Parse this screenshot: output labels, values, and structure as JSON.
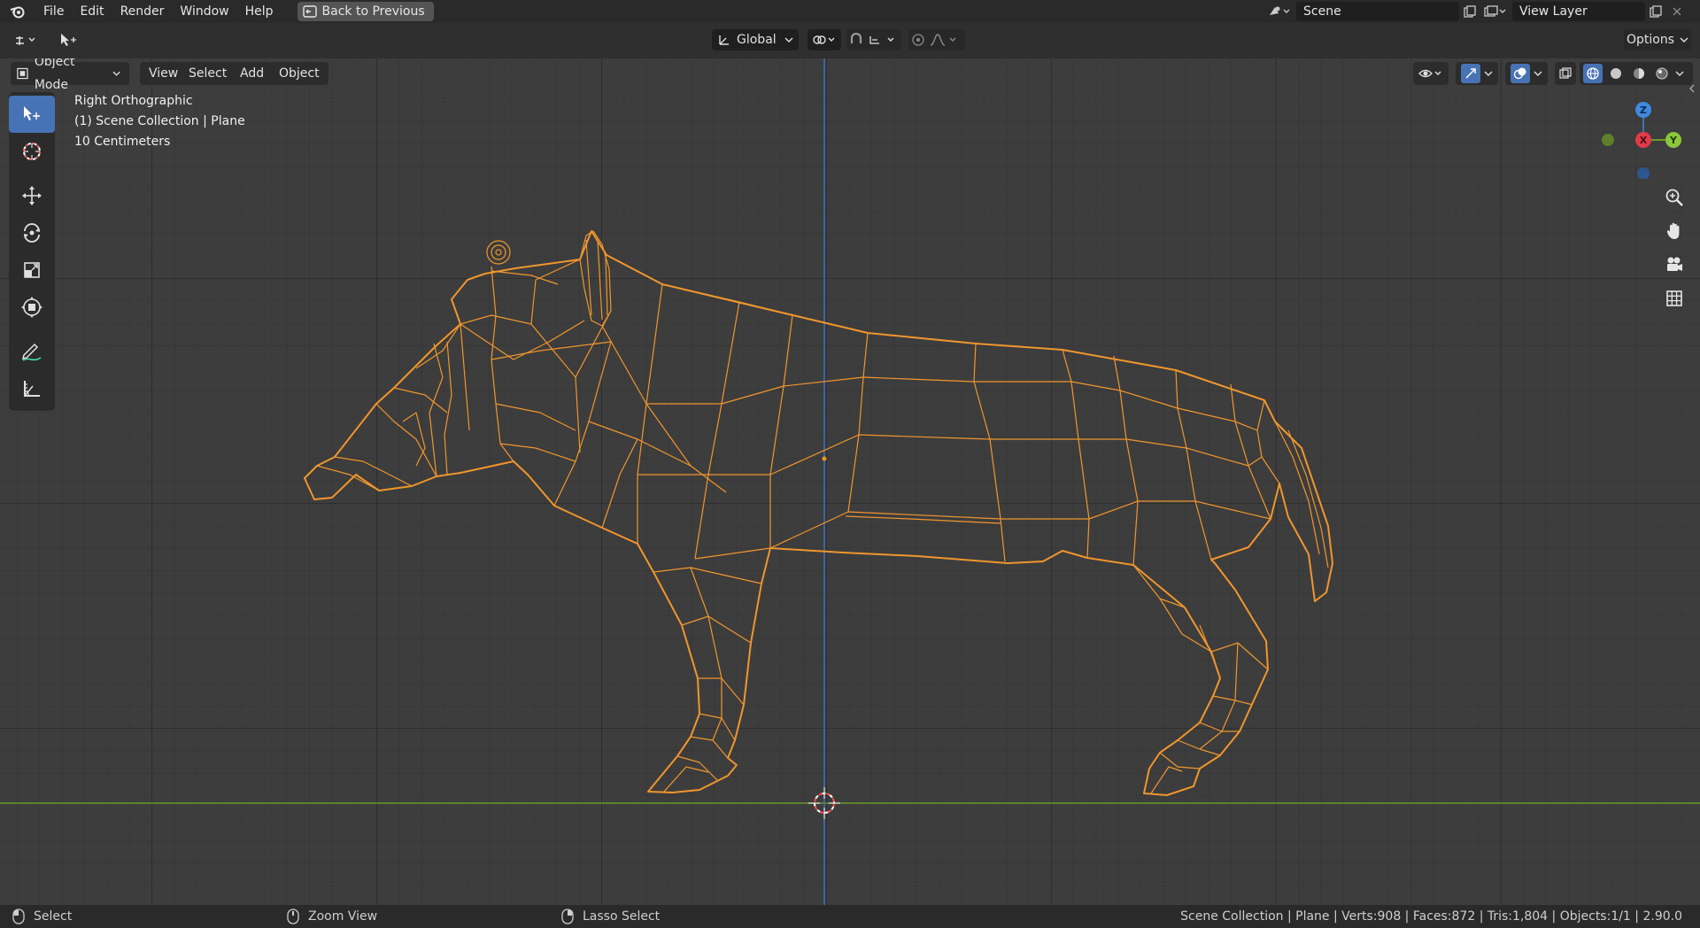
{
  "topbar": {
    "menus": [
      "File",
      "Edit",
      "Render",
      "Window",
      "Help"
    ],
    "back_button": "Back to Previous",
    "scene": "Scene",
    "view_layer": "View Layer"
  },
  "header": {
    "transform_orientation": "Global",
    "options_label": "Options",
    "mode": "Object Mode",
    "view_menus": [
      "View",
      "Select",
      "Add",
      "Object"
    ]
  },
  "viewport": {
    "view_name": "Right Orthographic",
    "collection": "(1) Scene Collection | Plane",
    "scale": "10 Centimeters",
    "gizmo": {
      "z": "Z",
      "x": "X",
      "y": "Y"
    }
  },
  "statusbar": {
    "left_action": "Select",
    "middle_action": "Zoom View",
    "right_action": "Lasso Select",
    "stats": "Scene Collection | Plane | Verts:908 | Faces:872 | Tris:1,804 | Objects:1/1 | 2.90.0"
  },
  "colors": {
    "accent": "#4772b3",
    "wire": "#f0962d",
    "axis_y": "#6b9a2a",
    "axis_z": "#3d72b8"
  }
}
